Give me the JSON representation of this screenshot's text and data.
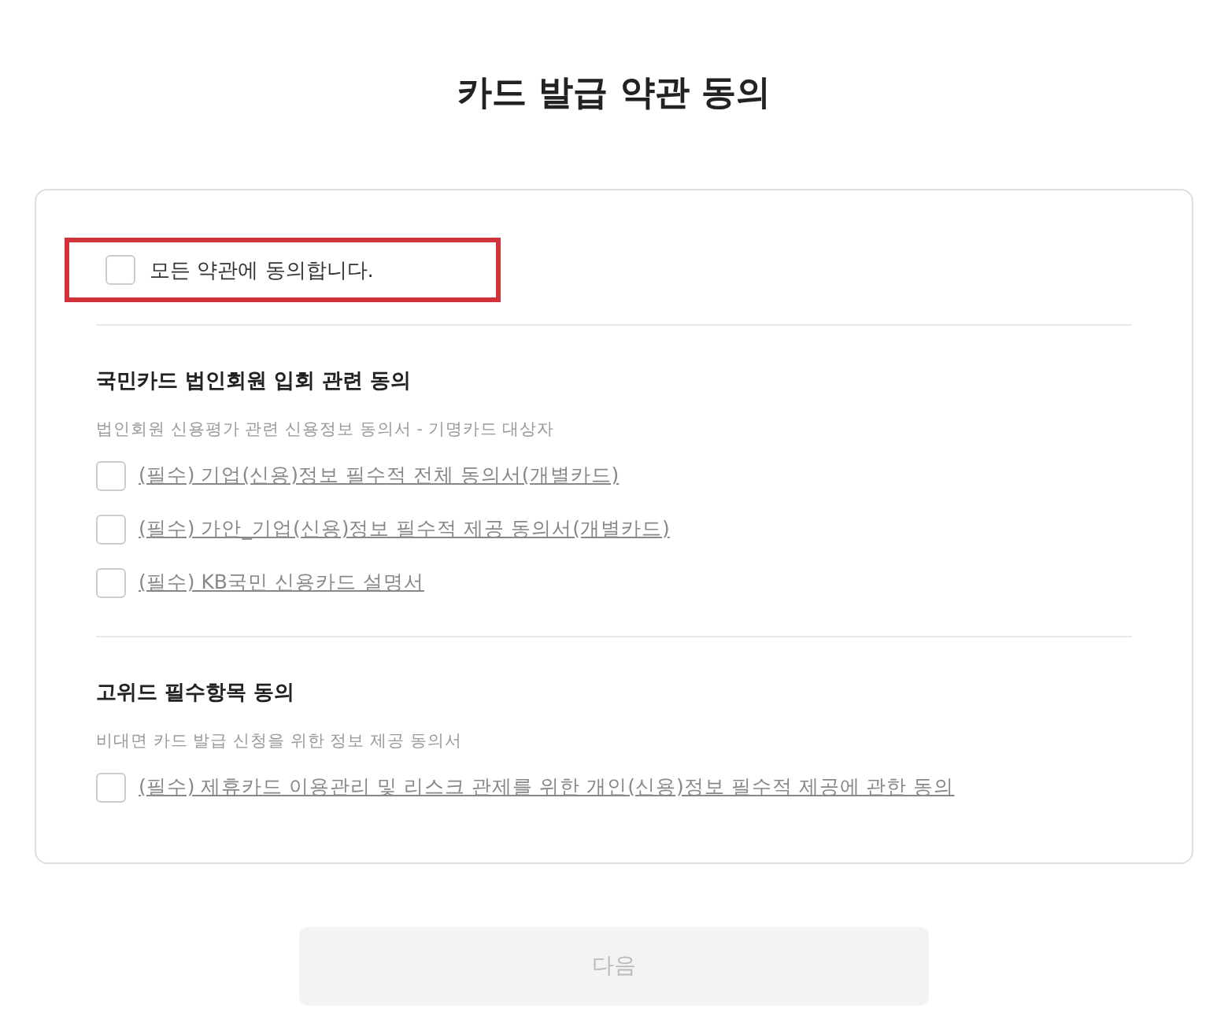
{
  "title": "카드 발급 약관 동의",
  "agree_all": {
    "label": "모든 약관에 동의합니다.",
    "checked": false,
    "highlighted": true
  },
  "sections": [
    {
      "title": "국민카드 법인회원 입회 관련 동의",
      "description": "법인회원 신용평가 관련 신용정보 동의서 - 기명카드 대상자",
      "items": [
        {
          "label": "(필수) 기업(신용)정보 필수적 전체 동의서(개별카드)",
          "checked": false
        },
        {
          "label": "(필수) 가안_기업(신용)정보 필수적 제공 동의서(개별카드)",
          "checked": false
        },
        {
          "label": "(필수) KB국민 신용카드 설명서",
          "checked": false
        }
      ]
    },
    {
      "title": "고위드 필수항목 동의",
      "description": "비대면 카드 발급 신청을 위한 정보 제공 동의서",
      "items": [
        {
          "label": "(필수) 제휴카드 이용관리 및 리스크 관제를 위한 개인(신용)정보 필수적 제공에 관한 동의",
          "checked": false
        }
      ]
    }
  ],
  "next_button": {
    "label": "다음",
    "disabled": true
  }
}
